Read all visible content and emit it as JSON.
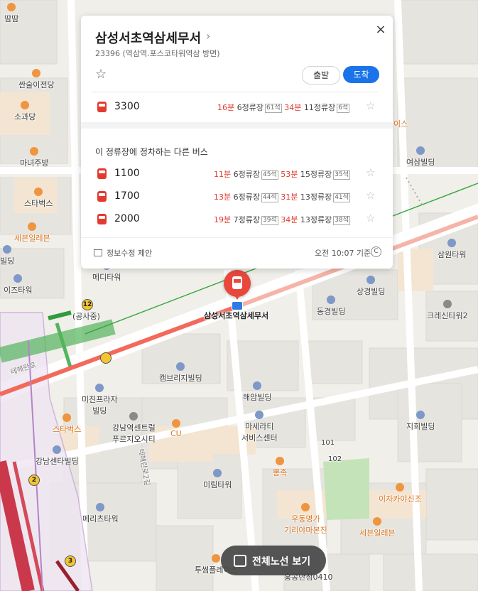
{
  "panel": {
    "title": "삼성서초역삼세무서",
    "subtitle": "23396 (역삼역.포스코타워역삼 방면)",
    "close": "×",
    "chevron": "›",
    "depart_label": "출발",
    "arrive_label": "도착",
    "star": "☆",
    "main_bus": {
      "number": "3300",
      "a1_min": "16분",
      "a1_stops": "6정류장",
      "a1_seats": "61석",
      "a2_min": "34분",
      "a2_stops": "11정류장",
      "a2_seats": "6석"
    },
    "other_heading": "이 정류장에 정차하는 다른 버스",
    "other_buses": [
      {
        "number": "1100",
        "a1_min": "11분",
        "a1_stops": "6정류장",
        "a1_seats": "45석",
        "a2_min": "53분",
        "a2_stops": "15정류장",
        "a2_seats": "35석"
      },
      {
        "number": "1700",
        "a1_min": "13분",
        "a1_stops": "6정류장",
        "a1_seats": "44석",
        "a2_min": "31분",
        "a2_stops": "13정류장",
        "a2_seats": "41석"
      },
      {
        "number": "2000",
        "a1_min": "19분",
        "a1_stops": "7정류장",
        "a1_seats": "39석",
        "a2_min": "34분",
        "a2_stops": "13정류장",
        "a2_seats": "38석"
      }
    ],
    "footer_edit": "정보수정 제안",
    "footer_time": "오전 10:07 기준",
    "refresh": "C"
  },
  "marker": {
    "stop_name": "삼성서초역삼세무서"
  },
  "full_route_button": "전체노선 보기",
  "map": {
    "pois": {
      "p1": "땀땀",
      "p2": "싼술이전당",
      "p3": "소과당",
      "p4": "마녀주방",
      "p5": "스타벅스",
      "p6": "세븐일레븐",
      "p7": "빌딩",
      "p8": "이즈타워",
      "p9": "메디타워",
      "p10": "(공사중)",
      "p11": "상경빌딩",
      "p12": "동경빌딩",
      "p13": "크레신타워2",
      "p14": "삼원타워",
      "p15": "여삼빌딩",
      "p16": "이스",
      "p17": "캠브리지빌딩",
      "p18": "미진프라자",
      "p19": "빌딩",
      "p20": "스타벅스",
      "p21": "강남역센트럴",
      "p22": "푸르지오시티",
      "p23": "CU",
      "p24": "강남센타빌딩",
      "p25": "해암빌딩",
      "p26": "마세라티",
      "p27": "서비스센터",
      "p28": "지희빌딩",
      "p29": "101",
      "p30": "102",
      "p31": "뽕족",
      "p32": "미림타워",
      "p33": "이자카야신조",
      "p34": "메리츠타워",
      "p35": "우동명가",
      "p36": "기리야마본진",
      "p37": "세븐일레븐",
      "p38": "투썸플레이스",
      "p39": "홍콩반점0410",
      "p40": "테헤란로",
      "p41": "테헤란로2길"
    },
    "badges": {
      "b12": "12",
      "b2": "2",
      "b3": "3"
    }
  }
}
